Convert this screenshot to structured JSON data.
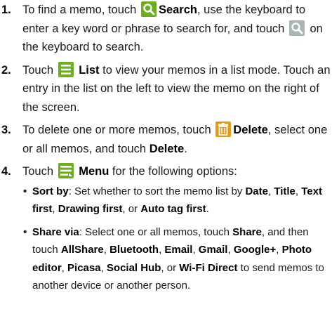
{
  "steps": [
    {
      "num": "1.",
      "t1": "To find a memo, touch",
      "b1": "Search",
      "t2": ", use the keyboard to enter a key word or phrase to search for, and touch",
      "t3": "on the keyboard to search."
    },
    {
      "num": "2.",
      "t1": "Touch",
      "b1": "List",
      "t2": "to view your memos in a list mode. Touch an entry in the list on the left to view the memo on the right of the screen."
    },
    {
      "num": "3.",
      "t1": "To delete one or more memos, touch",
      "b1": "Delete",
      "t2": ", select one or all memos, and touch",
      "b2": "Delete",
      "t3": "."
    },
    {
      "num": "4.",
      "t1": "Touch",
      "b1": "Menu",
      "t2": "for the following options:",
      "options": [
        {
          "b1": "Sort by",
          "t1": ": Set whether to sort the memo list by",
          "b2": "Date",
          "t2": ",",
          "b3": "Title",
          "t3": ",",
          "b4": "Text first",
          "t4": ",",
          "b5": "Drawing first",
          "t5": ", or",
          "b6": "Auto tag first",
          "t6": "."
        },
        {
          "b1": "Share via",
          "t1": ": Select one or all memos, touch",
          "b2": "Share",
          "t2": ", and then touch",
          "b3": "AllShare",
          "t3": ",",
          "b4": "Bluetooth",
          "t4": ",",
          "b5": "Email",
          "t5": ",",
          "b6": "Gmail",
          "t6": ",",
          "b7": "Google+",
          "t7": ",",
          "b8": "Photo editor",
          "t8": ",",
          "b9": "Picasa",
          "t9": ",",
          "b10": "Social Hub",
          "t10": ", or",
          "b11": "Wi-Fi Direct",
          "t11": "to send memos to another device or another person."
        }
      ]
    }
  ],
  "bullet": "•",
  "icons": {
    "search": "search-icon",
    "keyboard_search": "keyboard-search-icon",
    "list": "list-icon",
    "delete": "trash-icon",
    "menu": "menu-icon"
  },
  "colors": {
    "search_icon": "#6cae1f",
    "keyboard_search_icon": "#a8b4b5",
    "list_icon": "#6cae1f",
    "delete_icon": "#e49a12",
    "menu_icon": "#6cae1f"
  }
}
